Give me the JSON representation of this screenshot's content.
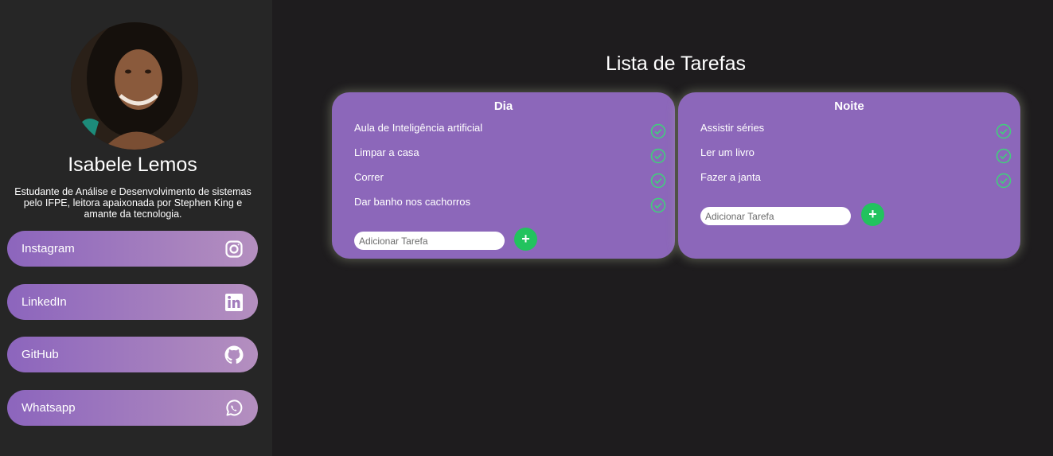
{
  "profile": {
    "name": "Isabele Lemos",
    "bio": "Estudante de Análise e Desenvolvimento de sistemas pelo IFPE, leitora apaixonada por Stephen King e amante da tecnologia."
  },
  "social_links": [
    {
      "label": "Instagram",
      "icon": "instagram-icon"
    },
    {
      "label": "LinkedIn",
      "icon": "linkedin-icon"
    },
    {
      "label": "GitHub",
      "icon": "github-icon"
    },
    {
      "label": "Whatsapp",
      "icon": "whatsapp-icon"
    }
  ],
  "main": {
    "title": "Lista de Tarefas",
    "lists": [
      {
        "title": "Dia",
        "tasks": [
          "Aula de Inteligência artificial",
          "Limpar a casa",
          "Correr",
          "Dar banho nos cachorros"
        ],
        "input_placeholder": "Adicionar Tarefa",
        "add_label": "+"
      },
      {
        "title": "Noite",
        "tasks": [
          "Assistir séries",
          "Ler um livro",
          "Fazer a janta"
        ],
        "input_placeholder": "Adicionar Tarefa",
        "add_label": "+"
      }
    ]
  },
  "colors": {
    "background": "#1e1c1e",
    "sidebar": "#262626",
    "card": "#8c67ba",
    "accent_green": "#22c35e",
    "check_green": "#3fd27a"
  }
}
